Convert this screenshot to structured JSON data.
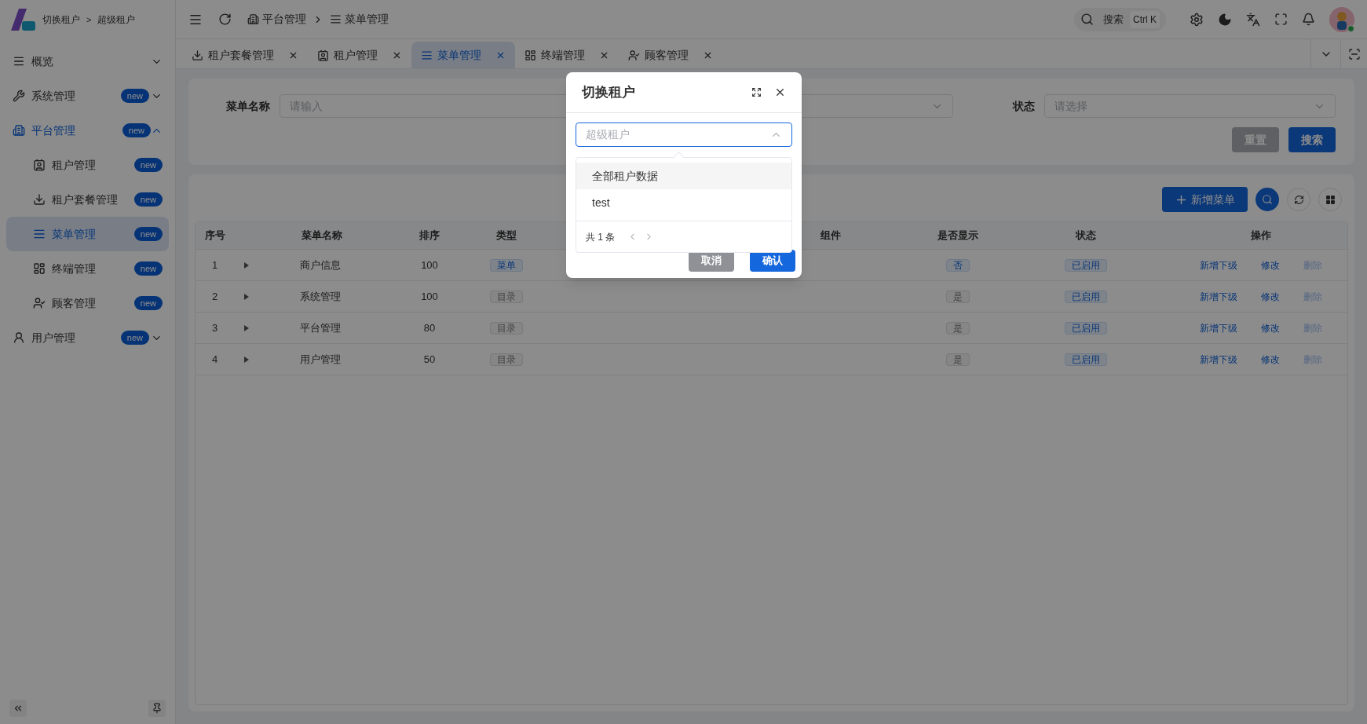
{
  "brand": {
    "switch_label": "切换租户",
    "separator": ">",
    "tenant": "超级租户"
  },
  "sidebar": {
    "items": [
      {
        "label": "概览",
        "expanded": false,
        "selected": false
      },
      {
        "label": "系统管理",
        "badge": "new",
        "expanded": false,
        "selected": false
      },
      {
        "label": "平台管理",
        "badge": "new",
        "expanded": true,
        "selected": false,
        "children": [
          {
            "label": "租户管理",
            "badge": "new",
            "selected": false
          },
          {
            "label": "租户套餐管理",
            "badge": "new",
            "selected": false
          },
          {
            "label": "菜单管理",
            "badge": "new",
            "selected": true
          },
          {
            "label": "终端管理",
            "badge": "new",
            "selected": false
          },
          {
            "label": "顾客管理",
            "badge": "new",
            "selected": false
          }
        ]
      },
      {
        "label": "用户管理",
        "badge": "new",
        "expanded": false,
        "selected": false
      }
    ]
  },
  "breadcrumb": [
    "平台管理",
    "菜单管理"
  ],
  "header": {
    "search_label": "搜索",
    "shortcut": "Ctrl K"
  },
  "tabs": [
    {
      "label": "租户套餐管理",
      "selected": false
    },
    {
      "label": "租户管理",
      "selected": false
    },
    {
      "label": "菜单管理",
      "selected": true
    },
    {
      "label": "终端管理",
      "selected": false
    },
    {
      "label": "顾客管理",
      "selected": false
    }
  ],
  "filters": [
    {
      "kind": "input",
      "label": "菜单名称",
      "placeholder": "请输入"
    },
    {
      "kind": "select"
    },
    {
      "kind": "select",
      "label": "状态",
      "placeholder": "请选择"
    }
  ],
  "filter_buttons": {
    "reset": "重置",
    "search": "搜索"
  },
  "toolbar": {
    "add": "新增菜单"
  },
  "table": {
    "columns": [
      "序号",
      "菜单名称",
      "排序",
      "类型",
      "组件",
      "是否显示",
      "状态",
      "操作"
    ],
    "rows": [
      {
        "index": "1",
        "name": "商户信息",
        "sort": "100",
        "type": {
          "text": "菜单",
          "kind": "menu"
        },
        "visible": {
          "text": "否",
          "kind": "no"
        },
        "status": "已启用",
        "actions": [
          {
            "label": "新增下级",
            "disabled": false
          },
          {
            "label": "修改",
            "disabled": false
          },
          {
            "label": "删除",
            "disabled": true
          }
        ]
      },
      {
        "index": "2",
        "name": "系统管理",
        "sort": "100",
        "type": {
          "text": "目录",
          "kind": "directory"
        },
        "visible": {
          "text": "是",
          "kind": "yes"
        },
        "status": "已启用",
        "actions": [
          {
            "label": "新增下级",
            "disabled": false
          },
          {
            "label": "修改",
            "disabled": false
          },
          {
            "label": "删除",
            "disabled": true
          }
        ]
      },
      {
        "index": "3",
        "name": "平台管理",
        "sort": "80",
        "type": {
          "text": "目录",
          "kind": "directory"
        },
        "visible": {
          "text": "是",
          "kind": "yes"
        },
        "status": "已启用",
        "actions": [
          {
            "label": "新增下级",
            "disabled": false
          },
          {
            "label": "修改",
            "disabled": false
          },
          {
            "label": "删除",
            "disabled": true
          }
        ]
      },
      {
        "index": "4",
        "name": "用户管理",
        "sort": "50",
        "type": {
          "text": "目录",
          "kind": "directory"
        },
        "visible": {
          "text": "是",
          "kind": "yes"
        },
        "status": "已启用",
        "actions": [
          {
            "label": "新增下级",
            "disabled": false
          },
          {
            "label": "修改",
            "disabled": false
          },
          {
            "label": "删除",
            "disabled": true
          }
        ]
      }
    ]
  },
  "modal": {
    "title": "切换租户",
    "select": {
      "placeholder": "超级租户",
      "expanded": true
    },
    "options": [
      {
        "label": "全部租户数据",
        "highlighted": true
      },
      {
        "label": "test",
        "highlighted": false
      }
    ],
    "pager": "共 1 条",
    "cancel": "取消",
    "confirm": "确认"
  }
}
